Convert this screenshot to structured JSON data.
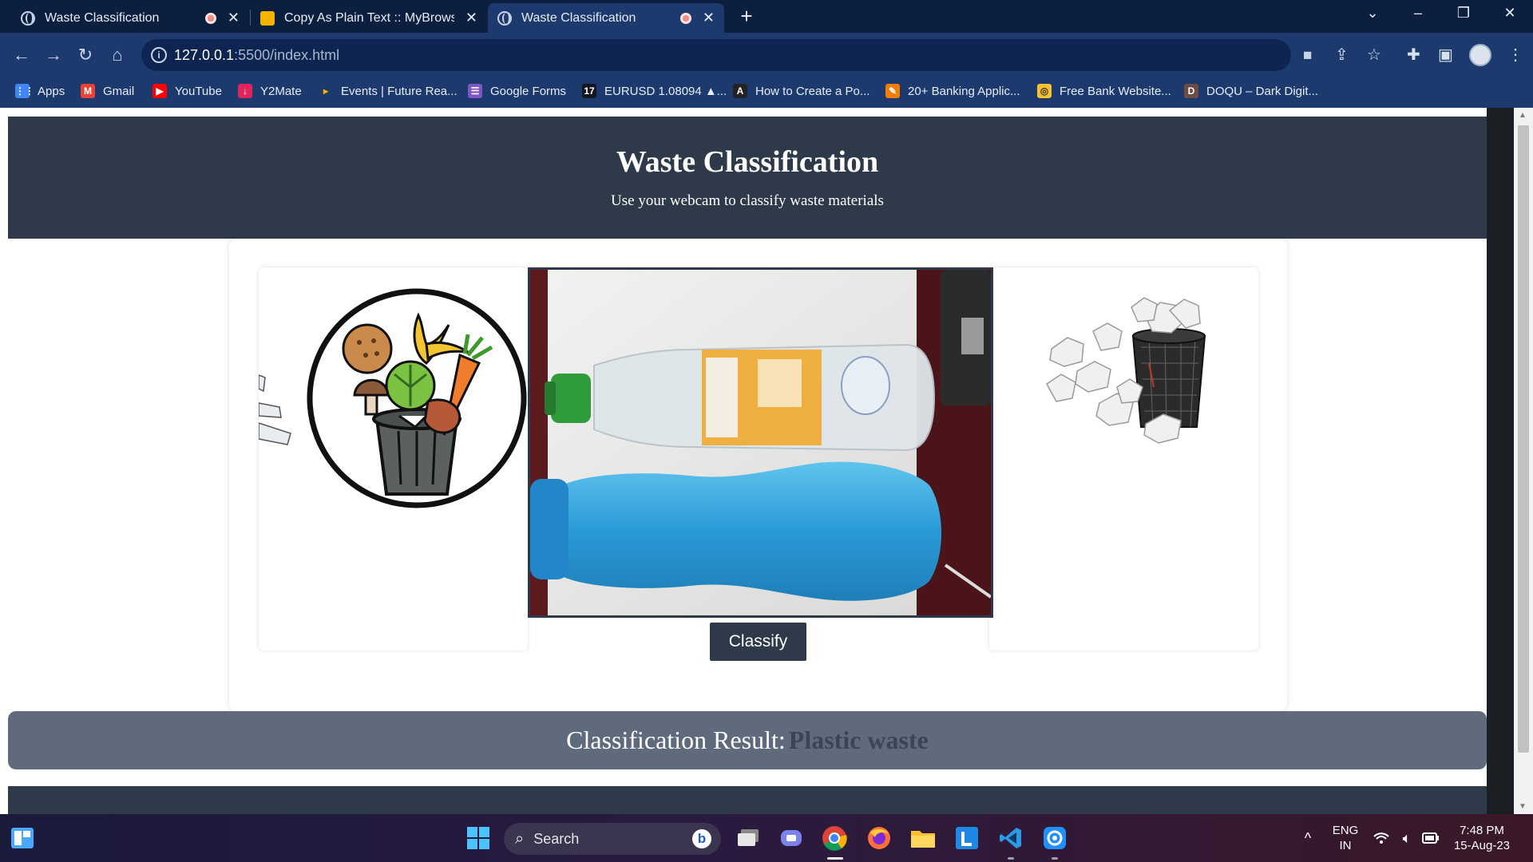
{
  "browser": {
    "tabs": [
      {
        "title": "Waste Classification",
        "recording": true,
        "active": false
      },
      {
        "title": "Copy As Plain Text :: MyBrowserA",
        "recording": false,
        "active": false
      },
      {
        "title": "Waste Classification",
        "recording": true,
        "active": true
      }
    ],
    "url_host": "127.0.0.1",
    "url_rest": ":5500/index.html",
    "bookmarks": [
      {
        "label": "Apps",
        "icon": "apps-grid-icon",
        "color": "#4285f4"
      },
      {
        "label": "Gmail",
        "icon": "gmail-icon",
        "color": "#ea4335"
      },
      {
        "label": "YouTube",
        "icon": "youtube-icon",
        "color": "#ff0000"
      },
      {
        "label": "Y2Mate",
        "icon": "y2mate-icon",
        "color": "#e0245e"
      },
      {
        "label": "Events | Future Rea...",
        "icon": "events-icon",
        "color": "#f4b400"
      },
      {
        "label": "Google Forms",
        "icon": "google-forms-icon",
        "color": "#7e57c2"
      },
      {
        "label": "EURUSD 1.08094 ▲...",
        "icon": "tradingview-icon",
        "color": "#131722"
      },
      {
        "label": "How to Create a Po...",
        "icon": "code-bracket-icon",
        "color": "#222222"
      },
      {
        "label": "20+ Banking Applic...",
        "icon": "pencil-icon",
        "color": "#f57c00"
      },
      {
        "label": "Free Bank Website...",
        "icon": "bank-site-icon",
        "color": "#fbc02d"
      },
      {
        "label": "DOQU – Dark Digit...",
        "icon": "doqu-icon",
        "color": "#6d4c41"
      }
    ]
  },
  "page": {
    "title": "Waste Classification",
    "subtitle": "Use your webcam to classify waste materials",
    "classify_label": "Classify",
    "result_label": "Classification Result:",
    "result_value": "Plastic waste"
  },
  "colors": {
    "header_bg": "#2e3a49",
    "result_bg": "#5f6b7c",
    "result_value": "#3a4656",
    "button_bg": "#2e3a49"
  },
  "taskbar": {
    "search_placeholder": "Search",
    "lang_top": "ENG",
    "lang_bottom": "IN",
    "time": "7:48 PM",
    "date": "15-Aug-23"
  }
}
